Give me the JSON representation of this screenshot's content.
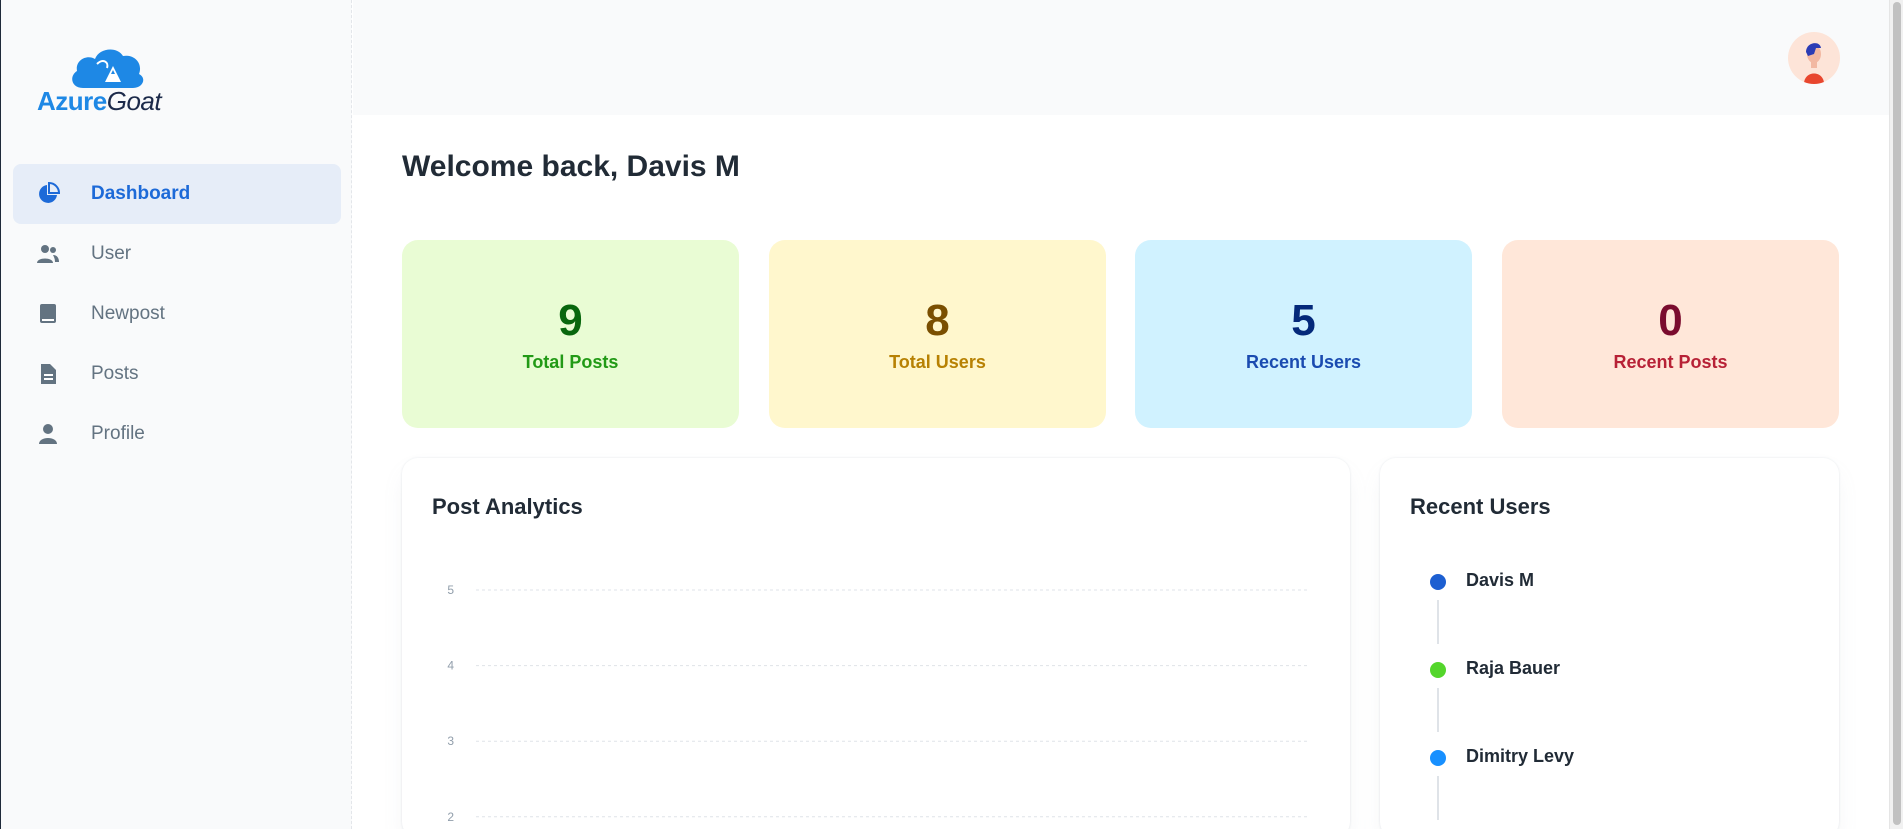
{
  "brand": {
    "part1": "Azure",
    "part2": "Goat"
  },
  "sidebar": {
    "items": [
      {
        "label": "Dashboard",
        "icon": "pie-chart-icon",
        "active": true
      },
      {
        "label": "User",
        "icon": "people-icon"
      },
      {
        "label": "Newpost",
        "icon": "book-icon"
      },
      {
        "label": "Posts",
        "icon": "document-icon"
      },
      {
        "label": "Profile",
        "icon": "person-icon"
      }
    ]
  },
  "main": {
    "welcome": "Welcome back, Davis M",
    "stats": [
      {
        "value": "9",
        "label": "Total Posts",
        "color": "#e9fcd4"
      },
      {
        "value": "8",
        "label": "Total Users",
        "color": "#fff7cd"
      },
      {
        "value": "5",
        "label": "Recent Users",
        "color": "#d0f2ff"
      },
      {
        "value": "0",
        "label": "Recent Posts",
        "color": "#ffe7d9"
      }
    ],
    "analytics": {
      "title": "Post Analytics"
    },
    "recent_users": {
      "title": "Recent Users",
      "items": [
        {
          "name": "Davis M",
          "color": "#1d5fd1"
        },
        {
          "name": "Raja Bauer",
          "color": "#54d62c"
        },
        {
          "name": "Dimitry Levy",
          "color": "#1890ff"
        }
      ]
    }
  },
  "chart_data": {
    "type": "line",
    "title": "Post Analytics",
    "y_ticks": [
      "5",
      "4",
      "3",
      "2"
    ],
    "ylim": [
      2,
      5
    ],
    "grid": true,
    "series": []
  }
}
